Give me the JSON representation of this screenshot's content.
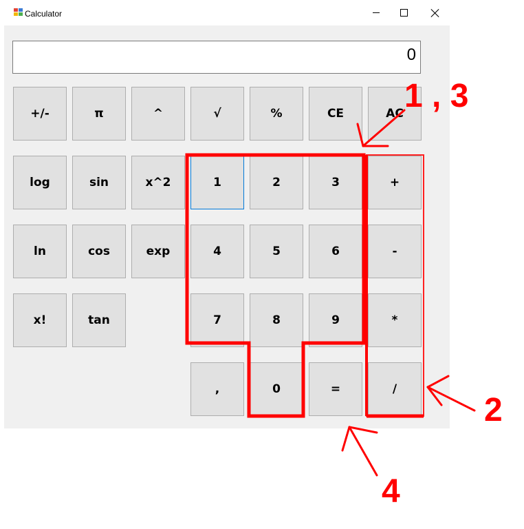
{
  "window": {
    "title": "Calculator",
    "icon": "app-icon"
  },
  "display": {
    "value": "0"
  },
  "keys": [
    [
      "+/-",
      "π",
      "^",
      "√",
      "%",
      "CE",
      "AC"
    ],
    [
      "log",
      "sin",
      "x^2",
      "1",
      "2",
      "3",
      "+"
    ],
    [
      "ln",
      "cos",
      "exp",
      "4",
      "5",
      "6",
      "-"
    ],
    [
      "x!",
      "tan",
      "7",
      "8",
      "9",
      "*"
    ],
    [
      ",",
      "0",
      "=",
      "/"
    ]
  ],
  "annotations": {
    "labels": [
      "1 , 3",
      "2",
      "4"
    ],
    "color": "#ff0000"
  },
  "colors": {
    "client_background": "#f0f0f0",
    "key_background": "#e1e1e1",
    "key_border": "#adadad",
    "focus_border": "#0078d7",
    "annotation": "#ff0000"
  }
}
